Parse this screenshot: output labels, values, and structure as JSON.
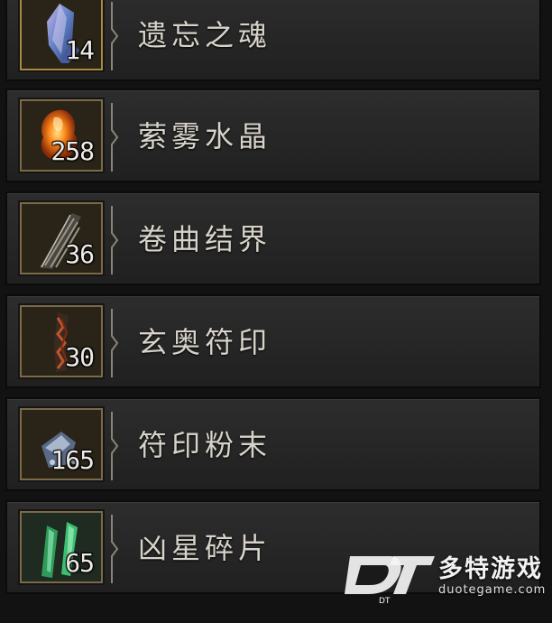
{
  "inventory": {
    "items": [
      {
        "name": "遗忘之魂",
        "count": "14",
        "icon": "forgotten-soul-crystal-icon"
      },
      {
        "name": "萦雾水晶",
        "count": "258",
        "icon": "veiled-crystal-icon"
      },
      {
        "name": "卷曲结界",
        "count": "36",
        "icon": "coiling-ward-icon"
      },
      {
        "name": "玄奥符印",
        "count": "30",
        "icon": "abstruse-sigil-icon"
      },
      {
        "name": "符印粉末",
        "count": "165",
        "icon": "sigil-powder-icon"
      },
      {
        "name": "凶星碎片",
        "count": "65",
        "icon": "baleful-fragment-icon"
      }
    ]
  },
  "watermark": {
    "site_name_cn": "多特游戏",
    "site_url": "duotegame.com",
    "logo_text": "DT"
  },
  "colors": {
    "row_bg": "#2a2a2a",
    "slot_border": "#7a6a48",
    "text": "#d7d3c9"
  }
}
